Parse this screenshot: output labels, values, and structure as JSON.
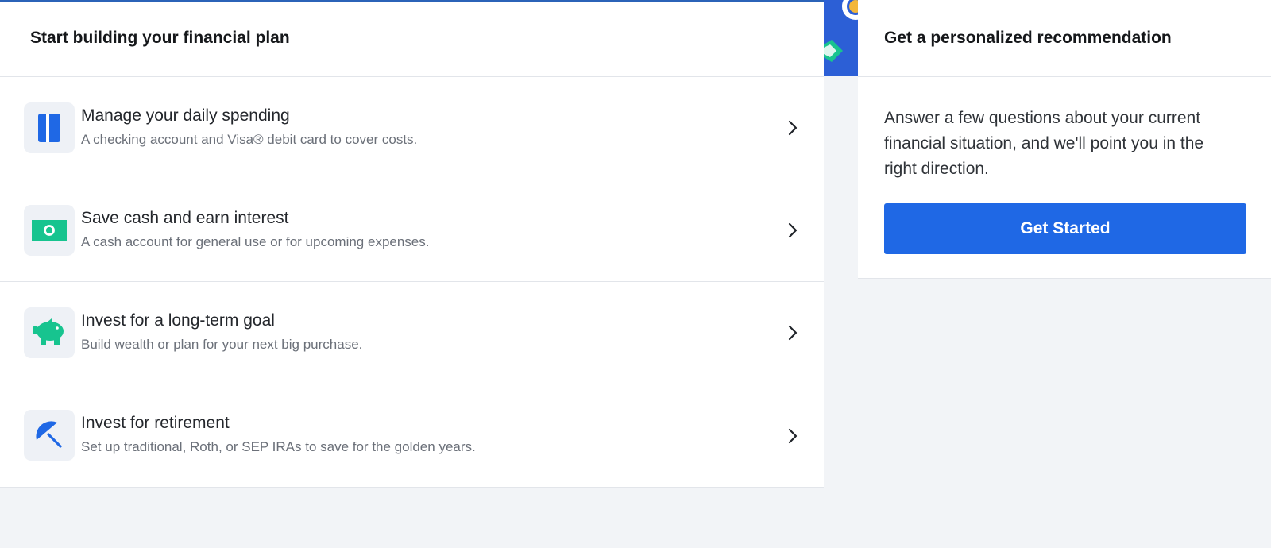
{
  "plan": {
    "heading": "Start building your financial plan",
    "options": [
      {
        "title": "Manage your daily spending",
        "description": "A checking account and Visa® debit card to cover costs.",
        "icon": "card-icon"
      },
      {
        "title": "Save cash and earn interest",
        "description": "A cash account for general use or for upcoming expenses.",
        "icon": "cash-icon"
      },
      {
        "title": "Invest for a long-term goal",
        "description": "Build wealth or plan for your next big purchase.",
        "icon": "piggy-bank-icon"
      },
      {
        "title": "Invest for retirement",
        "description": "Set up traditional, Roth, or SEP IRAs to save for the golden years.",
        "icon": "umbrella-icon"
      }
    ]
  },
  "recommendation": {
    "heading": "Get a personalized recommendation",
    "body": "Answer a few questions about your current financial situation, and we'll point you in the right direction.",
    "button_label": "Get Started"
  },
  "colors": {
    "accent_blue": "#1f68e5",
    "accent_green": "#17c48f",
    "background": "#f2f4f7"
  }
}
